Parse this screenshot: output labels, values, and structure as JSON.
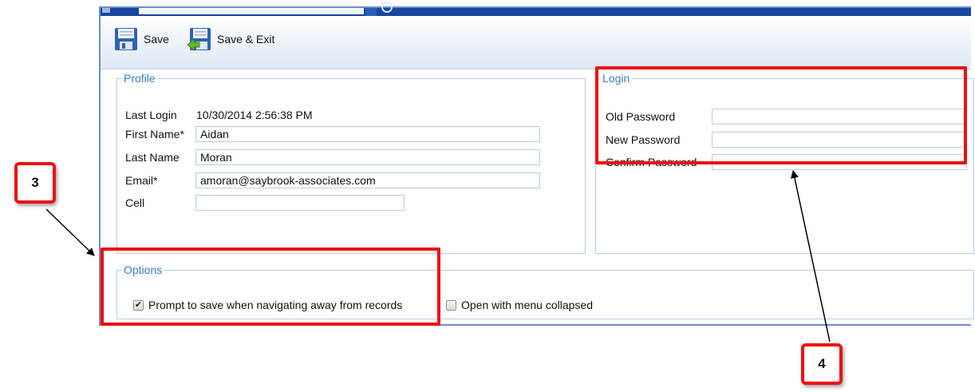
{
  "toolbar": {
    "save_label": "Save",
    "save_exit_label": "Save & Exit"
  },
  "profile": {
    "legend": "Profile",
    "last_login_label": "Last Login",
    "last_login_value": "10/30/2014 2:56:38 PM",
    "first_name_label": "First Name*",
    "first_name_value": "Aidan",
    "last_name_label": "Last Name",
    "last_name_value": "Moran",
    "email_label": "Email*",
    "email_value": "amoran@saybrook-associates.com",
    "cell_label": "Cell",
    "cell_value": ""
  },
  "login": {
    "legend": "Login",
    "old_password_label": "Old Password",
    "new_password_label": "New Password",
    "confirm_password_label": "Confirm Password"
  },
  "options": {
    "legend": "Options",
    "prompt_save_label": "Prompt to save when navigating away from records",
    "prompt_save_checked": true,
    "menu_collapsed_label": "Open with menu collapsed",
    "menu_collapsed_checked": false
  },
  "annotations": {
    "callout_3": "3",
    "callout_4": "4",
    "highlight_color": "#ee1010"
  },
  "colors": {
    "title_bar": "#17479e",
    "legend_text": "#3d79c8",
    "field_border": "#b8cce8"
  }
}
